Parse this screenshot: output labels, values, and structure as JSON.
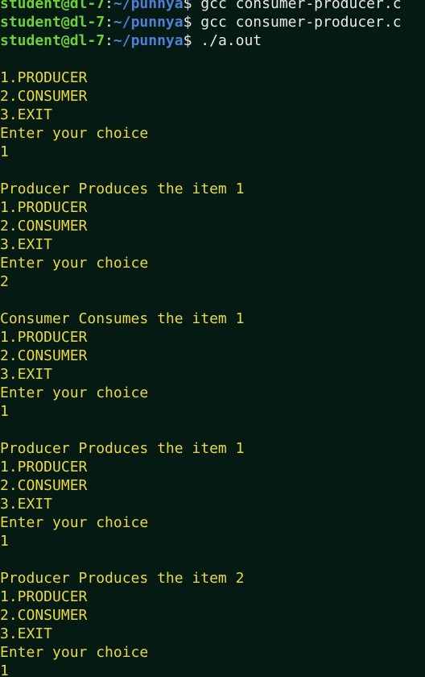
{
  "prompt": {
    "user_host": "student@dl-7",
    "colon": ":",
    "path": "~/punnya",
    "dollar": "$"
  },
  "lines": [
    {
      "type": "prompt",
      "command": "gcc consumer-producer.c"
    },
    {
      "type": "prompt",
      "command": "gcc consumer-producer.c"
    },
    {
      "type": "prompt",
      "command": "./a.out"
    },
    {
      "type": "text",
      "text": ""
    },
    {
      "type": "text",
      "text": "1.PRODUCER"
    },
    {
      "type": "text",
      "text": "2.CONSUMER"
    },
    {
      "type": "text",
      "text": "3.EXIT"
    },
    {
      "type": "text",
      "text": "Enter your choice"
    },
    {
      "type": "text",
      "text": "1"
    },
    {
      "type": "text",
      "text": ""
    },
    {
      "type": "text",
      "text": "Producer Produces the item 1"
    },
    {
      "type": "text",
      "text": "1.PRODUCER"
    },
    {
      "type": "text",
      "text": "2.CONSUMER"
    },
    {
      "type": "text",
      "text": "3.EXIT"
    },
    {
      "type": "text",
      "text": "Enter your choice"
    },
    {
      "type": "text",
      "text": "2"
    },
    {
      "type": "text",
      "text": ""
    },
    {
      "type": "text",
      "text": "Consumer Consumes the item 1"
    },
    {
      "type": "text",
      "text": "1.PRODUCER"
    },
    {
      "type": "text",
      "text": "2.CONSUMER"
    },
    {
      "type": "text",
      "text": "3.EXIT"
    },
    {
      "type": "text",
      "text": "Enter your choice"
    },
    {
      "type": "text",
      "text": "1"
    },
    {
      "type": "text",
      "text": ""
    },
    {
      "type": "text",
      "text": "Producer Produces the item 1"
    },
    {
      "type": "text",
      "text": "1.PRODUCER"
    },
    {
      "type": "text",
      "text": "2.CONSUMER"
    },
    {
      "type": "text",
      "text": "3.EXIT"
    },
    {
      "type": "text",
      "text": "Enter your choice"
    },
    {
      "type": "text",
      "text": "1"
    },
    {
      "type": "text",
      "text": ""
    },
    {
      "type": "text",
      "text": "Producer Produces the item 2"
    },
    {
      "type": "text",
      "text": "1.PRODUCER"
    },
    {
      "type": "text",
      "text": "2.CONSUMER"
    },
    {
      "type": "text",
      "text": "3.EXIT"
    },
    {
      "type": "text",
      "text": "Enter your choice"
    },
    {
      "type": "text",
      "text": "1"
    }
  ],
  "colors": {
    "background": "#051a12",
    "output_text": "#e9d94a",
    "prompt_user": "#6fcf3a",
    "prompt_path": "#4f7fd6",
    "command_text": "#e9e9e9"
  }
}
